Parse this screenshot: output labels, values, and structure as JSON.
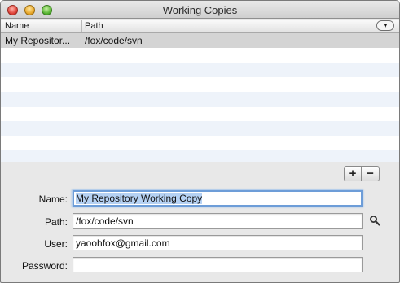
{
  "window": {
    "title": "Working Copies"
  },
  "table": {
    "columns": [
      "Name",
      "Path"
    ],
    "column_menu_icon": "triangle-down",
    "rows": [
      {
        "name": "My Repositor...",
        "path": "/fox/code/svn"
      }
    ]
  },
  "buttons": {
    "add_label": "+",
    "remove_label": "−"
  },
  "form": {
    "name_label": "Name:",
    "name_value": "My Repository Working Copy",
    "path_label": "Path:",
    "path_value": "/fox/code/svn",
    "user_label": "User:",
    "user_value": "yaoohfox@gmail.com",
    "password_label": "Password:",
    "password_value": "",
    "path_browse_icon": "magnifier-icon"
  }
}
